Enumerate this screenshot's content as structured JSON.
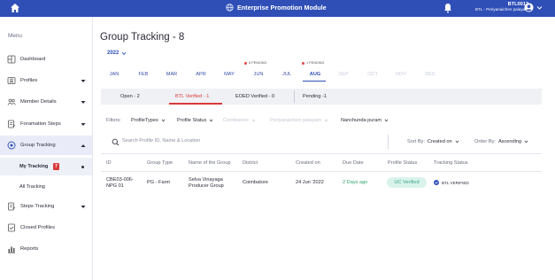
{
  "header": {
    "title": "Enterprise Promotion Module",
    "user_id": "BTL0012",
    "user_role": "BTL - Periyanaichen palayam"
  },
  "sidebar": {
    "menu_title": "Menu",
    "items": [
      {
        "label": "Dashboard",
        "icon": "dashboard-icon"
      },
      {
        "label": "Profiles",
        "icon": "profile-icon"
      },
      {
        "label": "Member Details",
        "icon": "members-icon"
      },
      {
        "label": "Foramation Steps",
        "icon": "steps-icon"
      },
      {
        "label": "Group Tracking",
        "icon": "tracking-icon"
      },
      {
        "label": "Steps Tracking",
        "icon": "steps-tracking-icon"
      },
      {
        "label": "Closed Profiles",
        "icon": "closed-profile-icon"
      },
      {
        "label": "Reports",
        "icon": "reports-icon"
      }
    ],
    "sub_items": [
      {
        "label": "My Tracking",
        "badge": "7"
      },
      {
        "label": "All Tracking"
      }
    ]
  },
  "main": {
    "title": "Group Tracking - 8",
    "year": "2022",
    "months": [
      {
        "label": "JAN"
      },
      {
        "label": "FEB"
      },
      {
        "label": "MAR"
      },
      {
        "label": "APR"
      },
      {
        "label": "MAY"
      },
      {
        "label": "JUN"
      },
      {
        "label": "JUL"
      },
      {
        "label": "AUG"
      },
      {
        "label": "SEP"
      },
      {
        "label": "OCT"
      },
      {
        "label": "NOV"
      },
      {
        "label": "DEC"
      }
    ],
    "pending_jun": "6 PENDING",
    "pending_aug": "1 PENDING",
    "status_tabs": [
      {
        "label": "Open - 2"
      },
      {
        "label": "BTL Verified - 1"
      },
      {
        "label": "EOED Verified - 0"
      },
      {
        "label": "Pending -1"
      }
    ],
    "filters_label": "Filters:",
    "filters": [
      {
        "label": "ProfileTypes"
      },
      {
        "label": "Profile Status"
      },
      {
        "label": "Coimbatore"
      },
      {
        "label": "Periyanaichen palayam"
      },
      {
        "label": "Nanchunda puram"
      }
    ],
    "search_placeholder": "Search Profile ID, Name & Location",
    "sort_by_label": "Sort By:",
    "sort_by_value": "Created on",
    "order_by_label": "Order By:",
    "order_by_value": "Ascending",
    "table": {
      "columns": [
        "ID",
        "Group Type",
        "Name of the Group",
        "District",
        "Created on",
        "Due Date",
        "Profile Status",
        "Tracking Status"
      ],
      "rows": [
        {
          "id_line1": "CBE03-006-",
          "id_line2": "NPG 01",
          "group_type": "PG - Farm",
          "name_line1": "Selva Vinayaga",
          "name_line2": "Producer Group",
          "district": "Coimbatore",
          "created_on": "24 Jun '2022",
          "due_date": "2 Days ago",
          "profile_status": "UC Verified",
          "tracking_status": "BTL VERIFIED"
        }
      ]
    }
  },
  "colors": {
    "brand": "#2f4fb7",
    "accent_red": "#d83a3a",
    "success_green": "#2ea86b"
  }
}
